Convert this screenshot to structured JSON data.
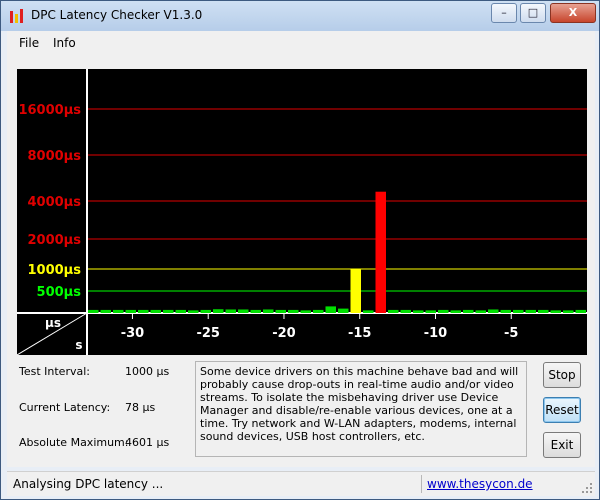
{
  "window": {
    "title": "DPC Latency Checker V1.3.0",
    "minimize": "–",
    "maximize": "□",
    "close": "X"
  },
  "menu": {
    "file": "File",
    "info": "Info"
  },
  "chart_data": {
    "type": "bar",
    "ylabels": [
      "16000µs",
      "8000µs",
      "4000µs",
      "2000µs",
      "1000µs",
      "500µs"
    ],
    "ylabel_colors": [
      "#e00000",
      "#e00000",
      "#e00000",
      "#e00000",
      "#ffff00",
      "#00ff00"
    ],
    "xticks": [
      -30,
      -25,
      -20,
      -15,
      -10,
      -5
    ],
    "xtick_labels": [
      "-30",
      "-25",
      "-20",
      "-15",
      "-10",
      "-5"
    ],
    "x_range": [
      -33,
      0
    ],
    "corner_top": "µs",
    "corner_bottom": "s",
    "values": [
      70,
      70,
      70,
      70,
      70,
      70,
      70,
      70,
      60,
      70,
      85,
      80,
      80,
      70,
      80,
      70,
      70,
      60,
      70,
      150,
      100,
      1000,
      60,
      4601,
      70,
      70,
      60,
      60,
      70,
      60,
      70,
      60,
      80,
      70,
      70,
      70,
      70,
      60,
      60,
      70
    ],
    "bar_colors": [
      "#00e000",
      "#00e000",
      "#00e000",
      "#00e000",
      "#00e000",
      "#00e000",
      "#00e000",
      "#00e000",
      "#00e000",
      "#00e000",
      "#00e000",
      "#00e000",
      "#00e000",
      "#00e000",
      "#00e000",
      "#00e000",
      "#00e000",
      "#00e000",
      "#00e000",
      "#00e000",
      "#00e000",
      "#ffff00",
      "#00e000",
      "#ff0000",
      "#00e000",
      "#00e000",
      "#00e000",
      "#00e000",
      "#00e000",
      "#00e000",
      "#00e000",
      "#00e000",
      "#00e000",
      "#00e000",
      "#00e000",
      "#00e000",
      "#00e000",
      "#00e000",
      "#00e000",
      "#00e000"
    ]
  },
  "params": [
    {
      "label": "Test Interval:",
      "value": "1000 µs"
    },
    {
      "label": "Current Latency:",
      "value": "78 µs"
    },
    {
      "label": "Absolute Maximum:",
      "value": "4601 µs"
    }
  ],
  "message": "Some device drivers on this machine behave bad and will probably cause drop-outs in real-time audio and/or video streams. To isolate the misbehaving driver use Device Manager and disable/re-enable various devices, one at a time. Try network and W-LAN adapters, modems, internal sound devices, USB host controllers, etc.",
  "buttons": {
    "stop": "Stop",
    "reset": "Reset",
    "exit": "Exit"
  },
  "status": {
    "text": "Analysing DPC latency ...",
    "link": "www.thesycon.de"
  }
}
